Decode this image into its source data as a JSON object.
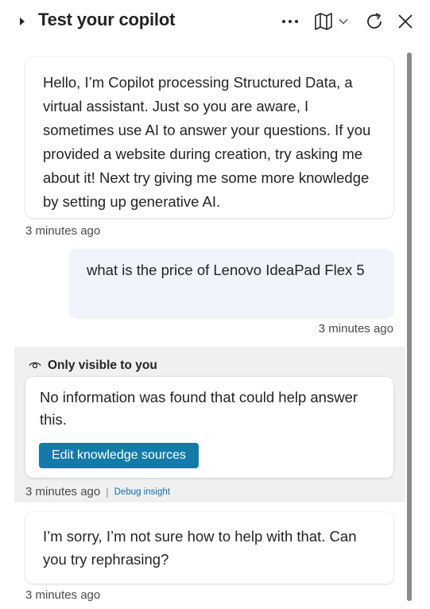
{
  "header": {
    "title": "Test your copilot",
    "more_icon": "ellipsis-icon",
    "map_icon": "map-icon",
    "chevron_icon": "chevron-down-icon",
    "refresh_icon": "refresh-icon",
    "close_icon": "close-icon"
  },
  "messages": [
    {
      "role": "bot",
      "text": "Hello, I’m Copilot processing Structured Data, a virtual assistant. Just so you are aware, I sometimes use AI to answer your questions. If you provided a website during creation, try asking me about it! Next try giving me some more knowledge by setting up generative AI.",
      "timestamp": "3 minutes ago"
    },
    {
      "role": "user",
      "text": "what is the price of Lenovo IdeaPad Flex 5",
      "timestamp": "3 minutes ago"
    },
    {
      "role": "bot-private",
      "visibility_label": "Only visible to you",
      "text": "No information was found that could help answer this.",
      "button_label": "Edit knowledge sources",
      "timestamp": "3 minutes ago",
      "debug_label": "Debug insight"
    },
    {
      "role": "bot",
      "text": "I’m sorry, I’m not sure how to help with that. Can you try rephrasing?",
      "timestamp": "3 minutes ago"
    }
  ],
  "colors": {
    "button": "#137baa",
    "user_bubble": "#eef4fa",
    "private_bg": "#f0f0f0",
    "link": "#0f6cbd"
  }
}
